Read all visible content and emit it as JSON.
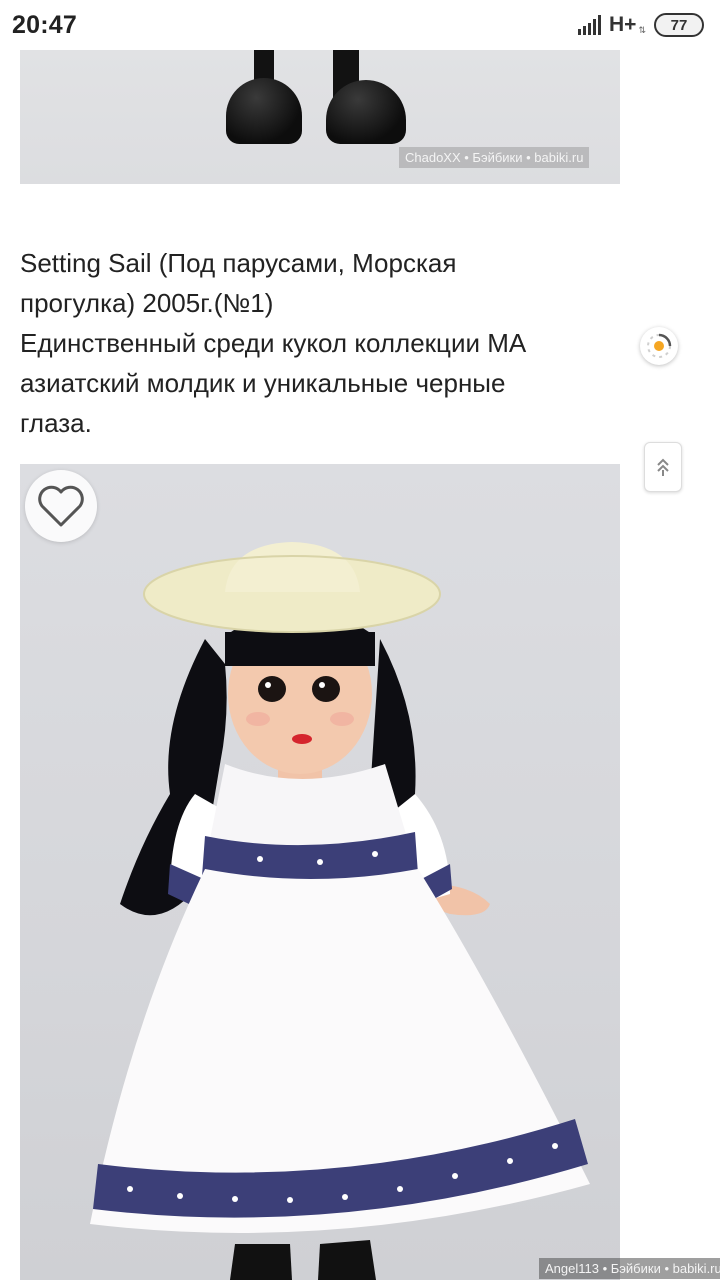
{
  "status_bar": {
    "time": "20:47",
    "network": "H+",
    "battery": "77",
    "signal_icon": "signal-bars-icon",
    "data_arrows_icon": "data-activity-icon"
  },
  "top_photo": {
    "watermark": "ChadoXX • Бэйбики • babiki.ru"
  },
  "caption": {
    "line1": "Setting Sail (Под парусами, Морская",
    "line2": "прогулка) 2005г.(№1)",
    "line3": "Единственный среди кукол коллекции МА",
    "line4": "азиатский молдик и уникальные черные",
    "line5": "глаза."
  },
  "side_buttons": {
    "loader_icon": "sun-loader-icon",
    "scroll_top_icon": "scroll-to-top-icon"
  },
  "main_photo": {
    "like_icon": "heart-icon",
    "watermark": "Angel113 • Бэйбики • babiki.ru"
  },
  "colors": {
    "dress_trim": "#3c3f78",
    "hat": "#efebc7",
    "hair": "#0d0d12",
    "loader_accent": "#f5a623"
  }
}
